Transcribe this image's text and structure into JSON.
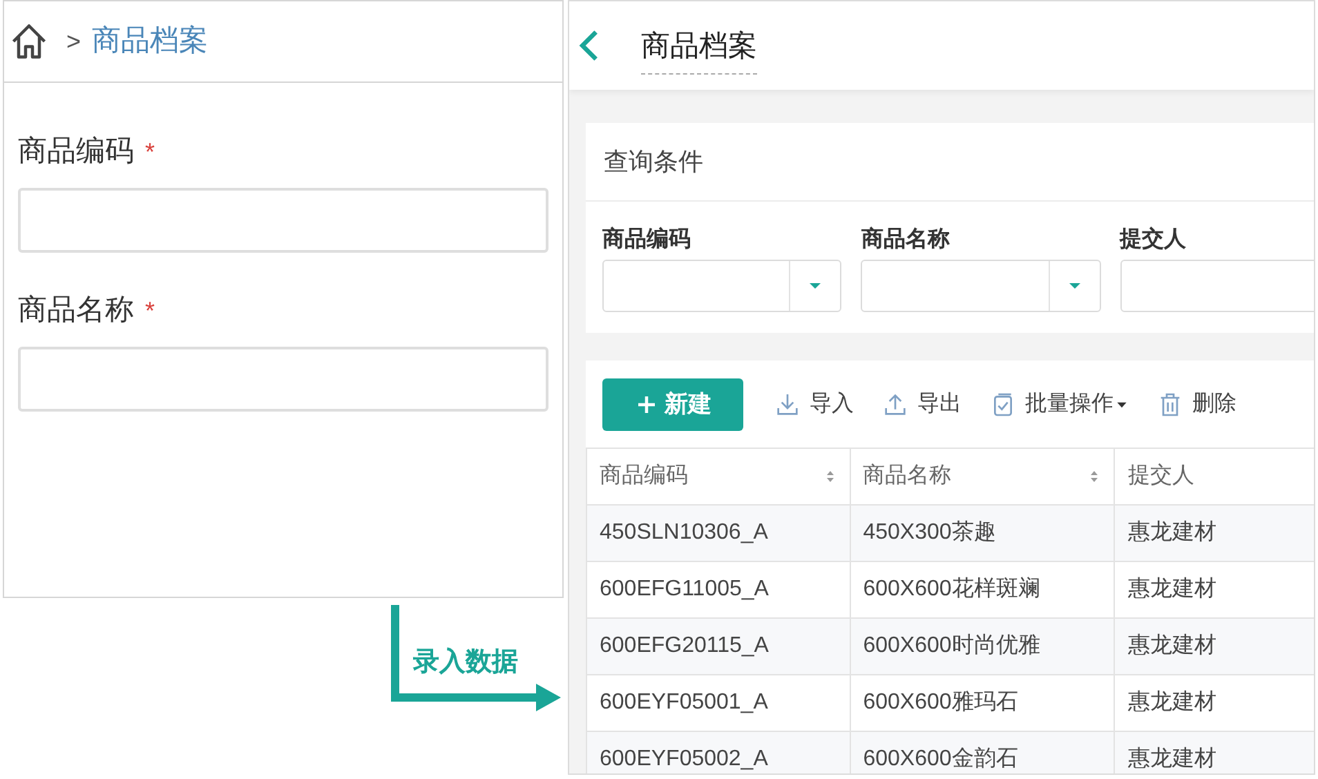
{
  "form_panel": {
    "breadcrumb": {
      "separator": ">",
      "current": "商品档案"
    },
    "fields": [
      {
        "label": "商品编码",
        "required_mark": "*"
      },
      {
        "label": "商品名称",
        "required_mark": "*"
      }
    ]
  },
  "callout": {
    "label": "录入数据"
  },
  "list_panel": {
    "title": "商品档案",
    "query": {
      "title": "查询条件",
      "filters": [
        {
          "label": "商品编码",
          "kind": "dropdown"
        },
        {
          "label": "商品名称",
          "kind": "dropdown"
        },
        {
          "label": "提交人",
          "kind": "text"
        }
      ]
    },
    "toolbar": [
      {
        "label": "新建",
        "kind": "primary"
      },
      {
        "label": "导入",
        "kind": "plain"
      },
      {
        "label": "导出",
        "kind": "plain"
      },
      {
        "label": "批量操作",
        "kind": "menu"
      },
      {
        "label": "删除",
        "kind": "plain"
      }
    ],
    "table": {
      "columns": [
        {
          "label": "商品编码",
          "sortable": true
        },
        {
          "label": "商品名称",
          "sortable": true
        },
        {
          "label": "提交人"
        }
      ],
      "rows": [
        [
          "450SLN10306_A",
          "450X300茶趣",
          "惠龙建材"
        ],
        [
          "600EFG11005_A",
          "600X600花样斑斓",
          "惠龙建材"
        ],
        [
          "600EFG20115_A",
          "600X600时尚优雅",
          "惠龙建材"
        ],
        [
          "600EYF05001_A",
          "600X600雅玛石",
          "惠龙建材"
        ],
        [
          "600EYF05002_A",
          "600X600金韵石",
          "惠龙建材"
        ]
      ]
    }
  }
}
